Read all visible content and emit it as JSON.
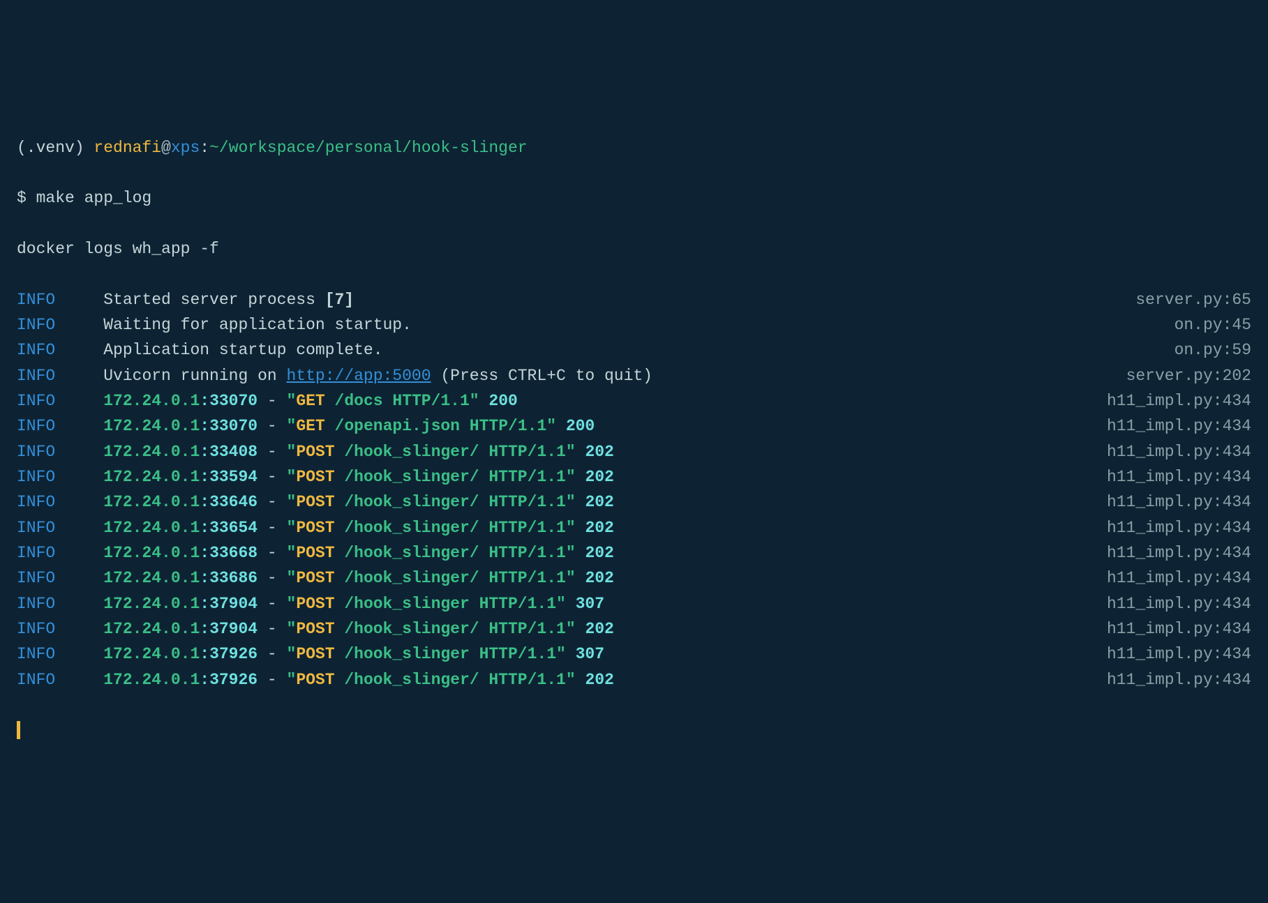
{
  "prompt": {
    "venv": "(.venv) ",
    "user": "rednafi",
    "at": "@",
    "host": "xps",
    "colon": ":",
    "path": "~/workspace/personal/hook-slinger",
    "dollar": "$ ",
    "command": "make app_log"
  },
  "echo": "docker logs wh_app -f",
  "level_label": "INFO",
  "gap": "     ",
  "startup": [
    {
      "msg_pre": "Started server process ",
      "msg_bold": "[7]",
      "msg_post": "",
      "src": "server.py:65"
    },
    {
      "msg_pre": "Waiting for application startup.",
      "msg_bold": "",
      "msg_post": "",
      "src": "on.py:45"
    },
    {
      "msg_pre": "Application startup complete.",
      "msg_bold": "",
      "msg_post": "",
      "src": "on.py:59"
    }
  ],
  "uvicorn": {
    "pre": "Uvicorn running on ",
    "link": "http://app:5000",
    "post": " (Press CTRL+C to quit)",
    "src": "server.py:202"
  },
  "requests": [
    {
      "ip": "172.24.0.1",
      "port": "33070",
      "method": "GET",
      "path": " /docs HTTP/1.1",
      "status": "200",
      "src": "h11_impl.py:434"
    },
    {
      "ip": "172.24.0.1",
      "port": "33070",
      "method": "GET",
      "path": " /openapi.json HTTP/1.1",
      "status": "200",
      "src": "h11_impl.py:434"
    },
    {
      "ip": "172.24.0.1",
      "port": "33408",
      "method": "POST",
      "path": " /hook_slinger/ HTTP/1.1",
      "status": "202",
      "src": "h11_impl.py:434"
    },
    {
      "ip": "172.24.0.1",
      "port": "33594",
      "method": "POST",
      "path": " /hook_slinger/ HTTP/1.1",
      "status": "202",
      "src": "h11_impl.py:434"
    },
    {
      "ip": "172.24.0.1",
      "port": "33646",
      "method": "POST",
      "path": " /hook_slinger/ HTTP/1.1",
      "status": "202",
      "src": "h11_impl.py:434"
    },
    {
      "ip": "172.24.0.1",
      "port": "33654",
      "method": "POST",
      "path": " /hook_slinger/ HTTP/1.1",
      "status": "202",
      "src": "h11_impl.py:434"
    },
    {
      "ip": "172.24.0.1",
      "port": "33668",
      "method": "POST",
      "path": " /hook_slinger/ HTTP/1.1",
      "status": "202",
      "src": "h11_impl.py:434"
    },
    {
      "ip": "172.24.0.1",
      "port": "33686",
      "method": "POST",
      "path": " /hook_slinger/ HTTP/1.1",
      "status": "202",
      "src": "h11_impl.py:434"
    },
    {
      "ip": "172.24.0.1",
      "port": "37904",
      "method": "POST",
      "path": " /hook_slinger HTTP/1.1",
      "status": "307",
      "src": "h11_impl.py:434"
    },
    {
      "ip": "172.24.0.1",
      "port": "37904",
      "method": "POST",
      "path": " /hook_slinger/ HTTP/1.1",
      "status": "202",
      "src": "h11_impl.py:434"
    },
    {
      "ip": "172.24.0.1",
      "port": "37926",
      "method": "POST",
      "path": " /hook_slinger HTTP/1.1",
      "status": "307",
      "src": "h11_impl.py:434"
    },
    {
      "ip": "172.24.0.1",
      "port": "37926",
      "method": "POST",
      "path": " /hook_slinger/ HTTP/1.1",
      "status": "202",
      "src": "h11_impl.py:434"
    }
  ],
  "sep_colon": ":",
  "sep_dash": " - ",
  "quote_char": "\""
}
